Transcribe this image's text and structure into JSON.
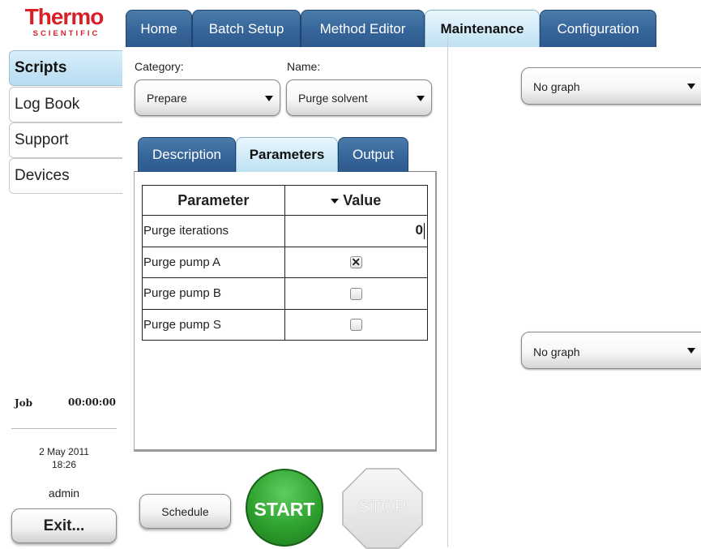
{
  "logo": {
    "name": "Thermo",
    "sub": "SCIENTIFIC"
  },
  "top_tabs": [
    {
      "label": "Home",
      "active": false
    },
    {
      "label": "Batch Setup",
      "active": false
    },
    {
      "label": "Method Editor",
      "active": false
    },
    {
      "label": "Maintenance",
      "active": true
    },
    {
      "label": "Configuration",
      "active": false
    }
  ],
  "sidebar": {
    "items": [
      {
        "label": "Scripts",
        "active": true
      },
      {
        "label": "Log Book",
        "active": false
      },
      {
        "label": "Support",
        "active": false
      },
      {
        "label": "Devices",
        "active": false
      }
    ],
    "job_label": "Job",
    "job_time": "00:00:00",
    "date": "2 May 2011",
    "time": "18:26",
    "user": "admin",
    "exit_label": "Exit..."
  },
  "form": {
    "category_label": "Category:",
    "category_value": "Prepare",
    "name_label": "Name:",
    "name_value": "Purge solvent"
  },
  "sub_tabs": [
    {
      "label": "Description",
      "active": false
    },
    {
      "label": "Parameters",
      "active": true
    },
    {
      "label": "Output",
      "active": false
    }
  ],
  "table": {
    "headers": [
      "Parameter",
      "Value"
    ],
    "rows": [
      {
        "name": "Purge iterations",
        "value": "0",
        "type": "number"
      },
      {
        "name": "Purge pump A",
        "value": true,
        "type": "checkbox"
      },
      {
        "name": "Purge pump B",
        "value": false,
        "type": "checkbox"
      },
      {
        "name": "Purge pump S",
        "value": false,
        "type": "checkbox"
      }
    ]
  },
  "buttons": {
    "schedule": "Schedule",
    "start": "START",
    "stop": "STOP"
  },
  "graphs": {
    "top": "No graph",
    "bottom": "No graph"
  },
  "colors": {
    "brand_red": "#d61f26",
    "tab_blue": "#36659a",
    "active_tab": "#cfeaf8",
    "start_green": "#2ea12e"
  },
  "icons": {
    "dropdown": "triangle-down",
    "checkbox_checked": "x-mark",
    "stop": "octagon"
  }
}
